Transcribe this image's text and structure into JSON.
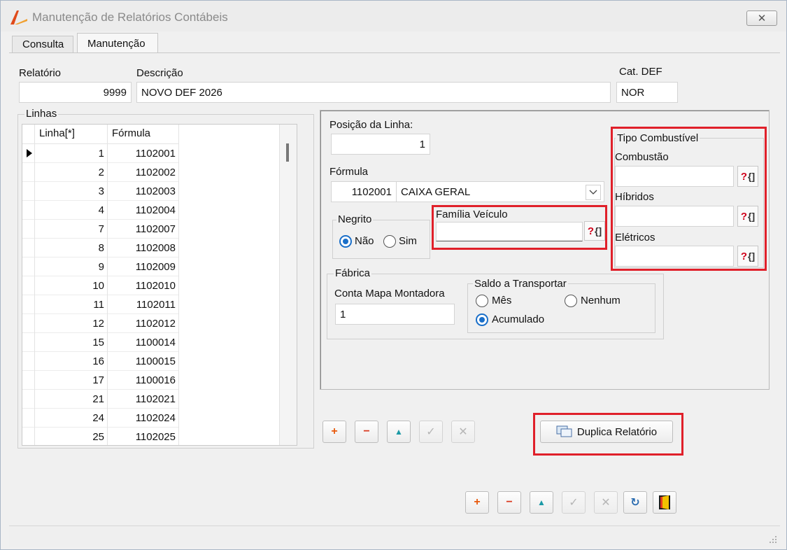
{
  "window": {
    "title": "Manutenção de Relatórios Contábeis",
    "close_glyph": "✕"
  },
  "tabs": [
    {
      "label": "Consulta"
    },
    {
      "label": "Manutenção"
    }
  ],
  "header": {
    "relatorio_label": "Relatório",
    "relatorio_value": "9999",
    "descricao_label": "Descrição",
    "descricao_value": "NOVO DEF 2026",
    "cat_def_label": "Cat. DEF",
    "cat_def_value": "NOR"
  },
  "linhas": {
    "label": "Linhas",
    "columns": [
      "Linha[*]",
      "Fórmula"
    ],
    "rows": [
      {
        "linha": "1",
        "formula": "1102001"
      },
      {
        "linha": "2",
        "formula": "1102002"
      },
      {
        "linha": "3",
        "formula": "1102003"
      },
      {
        "linha": "4",
        "formula": "1102004"
      },
      {
        "linha": "7",
        "formula": "1102007"
      },
      {
        "linha": "8",
        "formula": "1102008"
      },
      {
        "linha": "9",
        "formula": "1102009"
      },
      {
        "linha": "10",
        "formula": "1102010"
      },
      {
        "linha": "11",
        "formula": "1102011"
      },
      {
        "linha": "12",
        "formula": "1102012"
      },
      {
        "linha": "15",
        "formula": "1100014"
      },
      {
        "linha": "16",
        "formula": "1100015"
      },
      {
        "linha": "17",
        "formula": "1100016"
      },
      {
        "linha": "21",
        "formula": "1102021"
      },
      {
        "linha": "24",
        "formula": "1102024"
      },
      {
        "linha": "25",
        "formula": "1102025"
      }
    ]
  },
  "detail": {
    "posicao_label": "Posição da Linha:",
    "posicao_value": "1",
    "formula_label": "Fórmula",
    "formula_code": "1102001",
    "formula_desc": "CAIXA GERAL",
    "negrito_label": "Negrito",
    "negrito_nao": "Não",
    "negrito_sim": "Sim",
    "familia_label": "Família Veículo",
    "familia_value": "",
    "fabrica_label": "Fábrica",
    "conta_mapa_label": "Conta Mapa Montadora",
    "conta_mapa_value": "1",
    "saldo_label": "Saldo a Transportar",
    "saldo_mes": "Mês",
    "saldo_nenhum": "Nenhum",
    "saldo_acumulado": "Acumulado",
    "tipo_comb_label": "Tipo Combustível",
    "combustao_label": "Combustão",
    "combustao_value": "",
    "hibridos_label": "Híbridos",
    "hibridos_value": "",
    "eletricos_label": "Elétricos",
    "eletricos_value": ""
  },
  "lookup_button": {
    "glyph_q": "?",
    "glyph_b": "{]"
  },
  "line_toolbar": {
    "add": "+",
    "remove": "−",
    "up": "▲",
    "confirm": "✓",
    "cancel": "✕"
  },
  "duplica_button": {
    "label": "Duplica Relatório"
  },
  "main_toolbar": {
    "add": "+",
    "remove": "−",
    "up": "▲",
    "confirm": "✓",
    "cancel": "✕",
    "refresh": "↻",
    "exit": "▮"
  },
  "colors": {
    "highlight": "#e0202a",
    "radio_active": "#1a6fc9",
    "add": "#e8590c",
    "remove": "#d9381e",
    "up": "#1c9aa6"
  }
}
